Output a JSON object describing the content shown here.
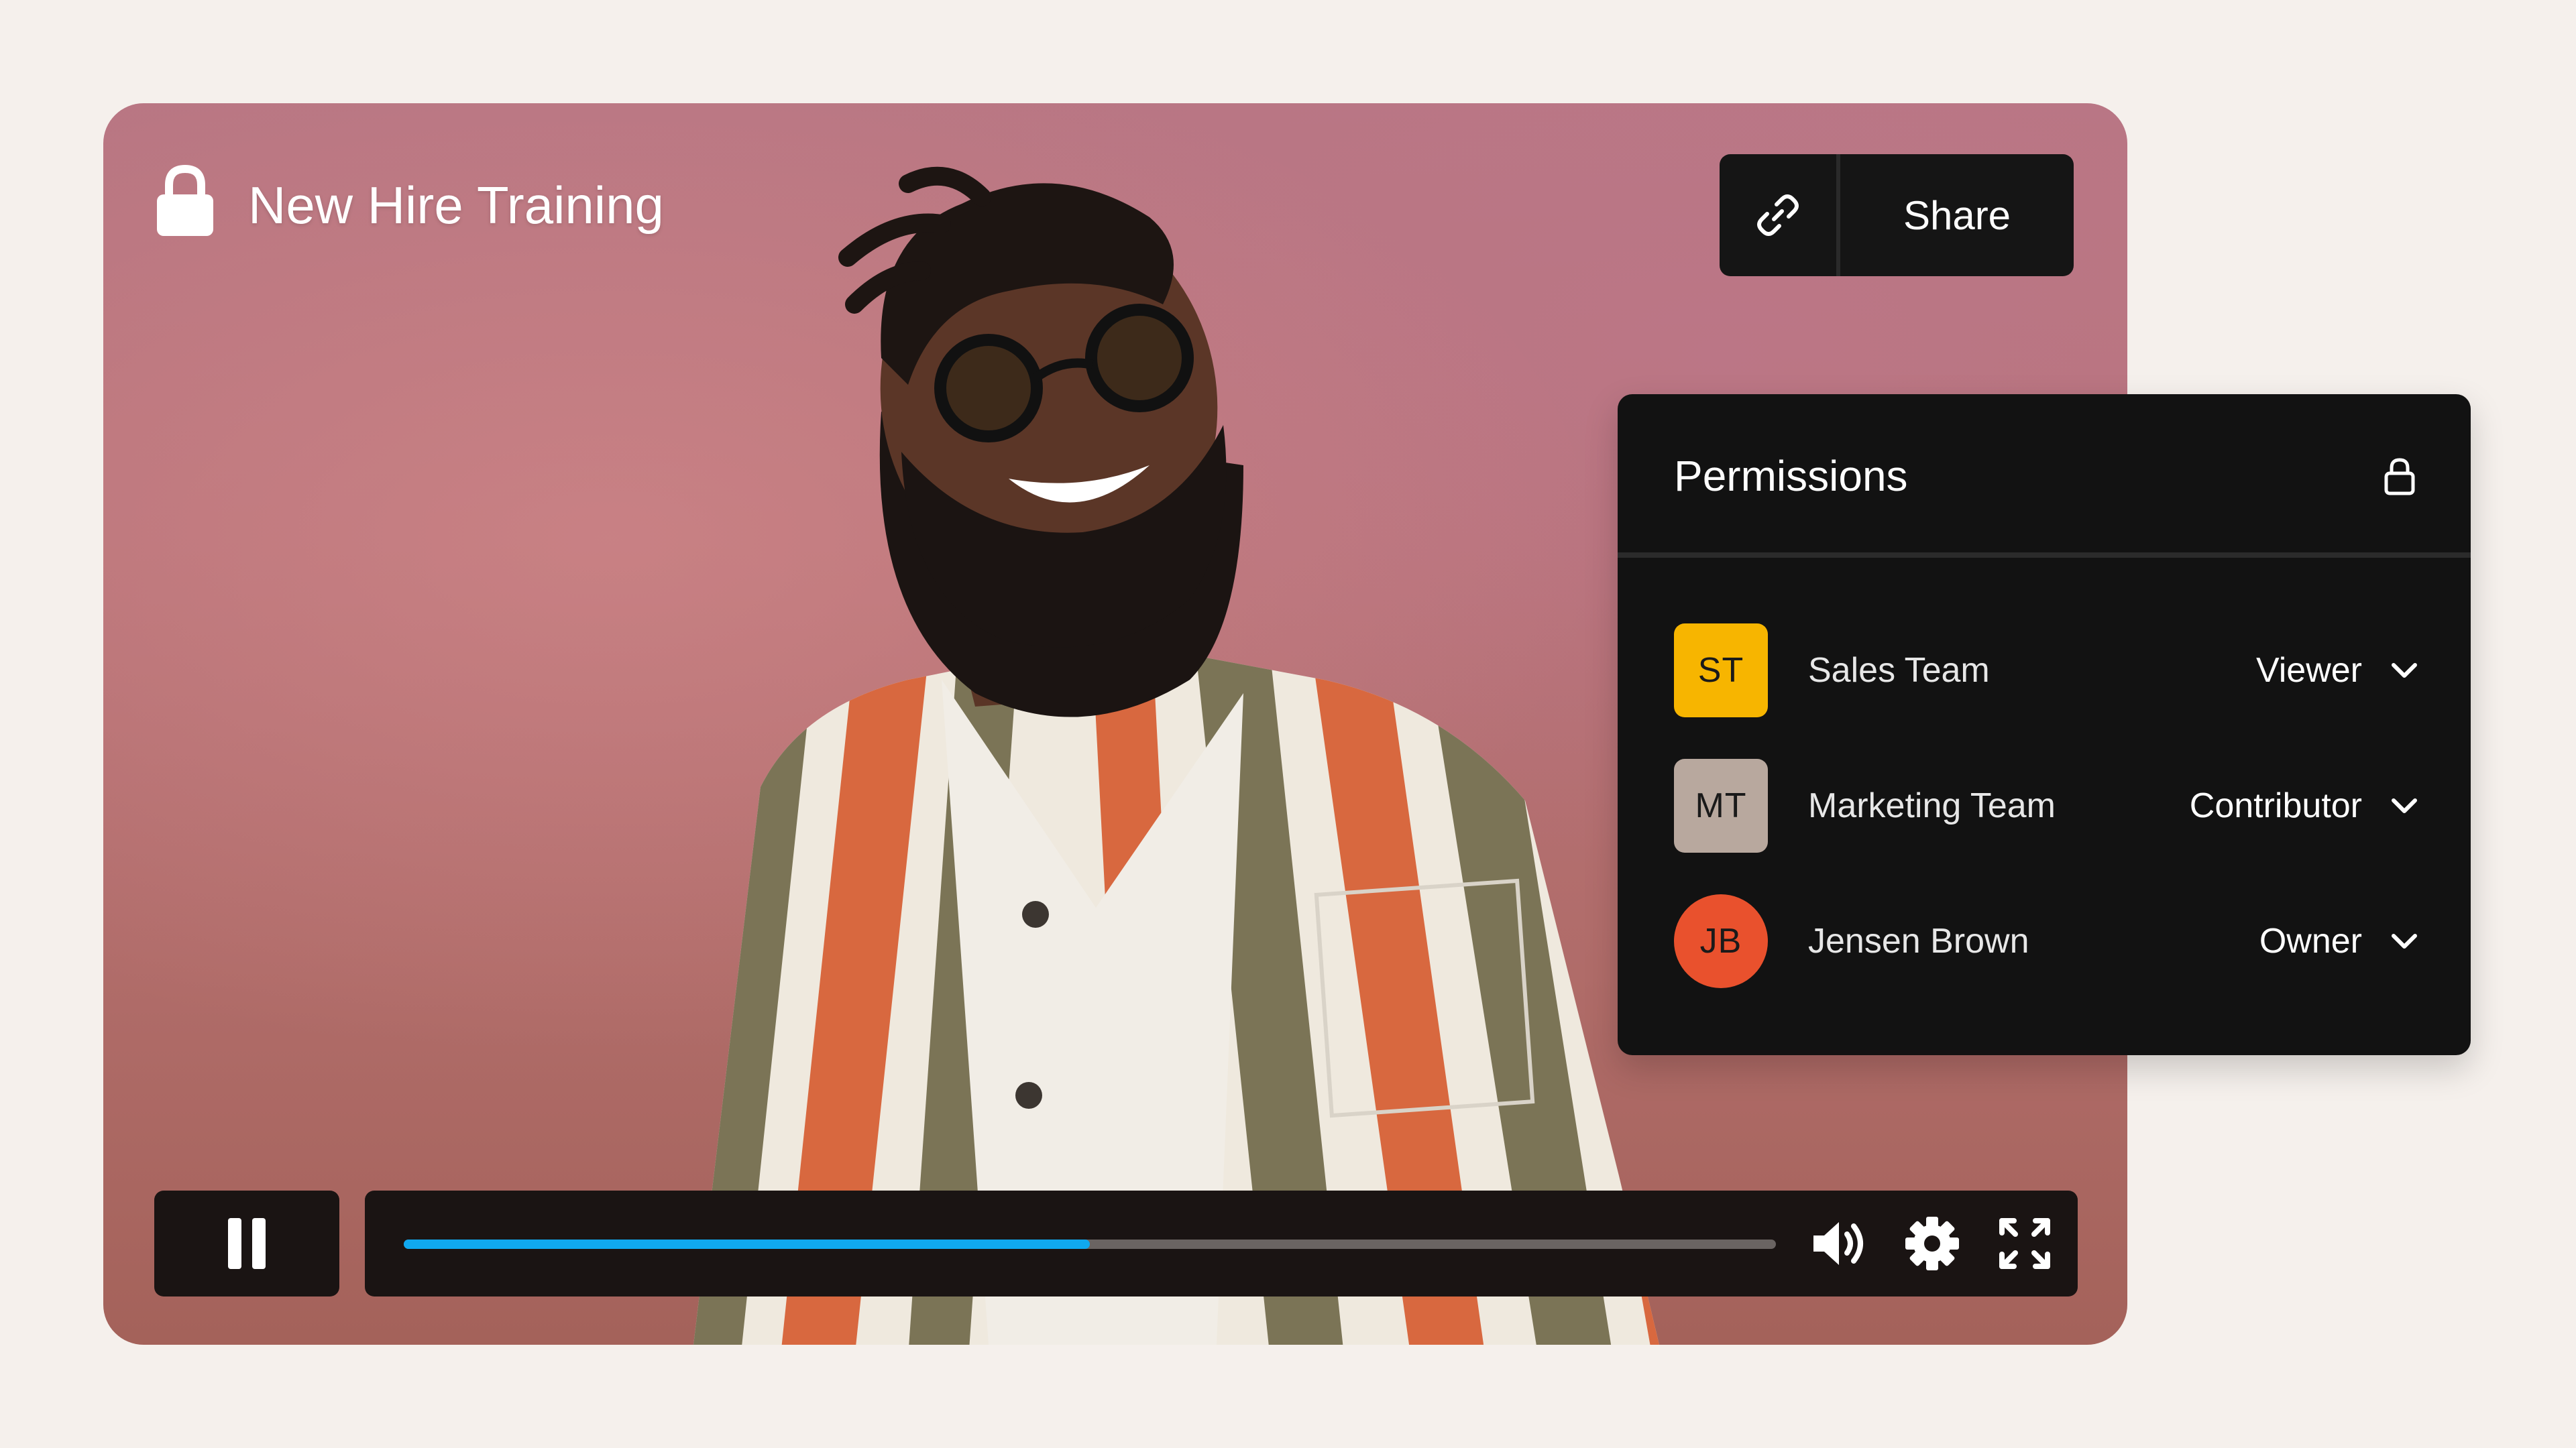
{
  "video": {
    "title": "New Hire Training",
    "progress": 0.5
  },
  "share": {
    "label": "Share"
  },
  "permissions": {
    "title": "Permissions",
    "members": [
      {
        "initials": "ST",
        "name": "Sales Team",
        "role": "Viewer",
        "color": "#f7b500",
        "shape": "square"
      },
      {
        "initials": "MT",
        "name": "Marketing Team",
        "role": "Contributor",
        "color": "#b8a89e",
        "shape": "square"
      },
      {
        "initials": "JB",
        "name": "Jensen Brown",
        "role": "Owner",
        "color": "#e9512d",
        "shape": "round"
      }
    ]
  },
  "colors": {
    "background": "#f5f0ec",
    "panel": "#121212",
    "progress": "#10a8ef",
    "video_backdrop": "#b8737a"
  },
  "icons": {
    "title": "lock-icon",
    "share": "link-icon",
    "permissions": "lock-icon",
    "playback": "pause-icon",
    "volume": "volume-icon",
    "settings": "gear-icon",
    "fullscreen": "fullscreen-icon",
    "role": "chevron-down-icon"
  }
}
